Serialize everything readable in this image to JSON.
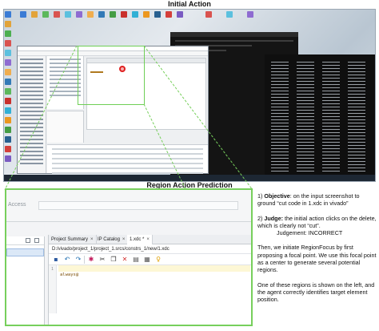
{
  "headings": {
    "initial_action": "Initial Action",
    "region_action_prediction": "Region Action Prediction"
  },
  "zoom": {
    "access_label": "Access",
    "tabs": [
      {
        "label": "Project Summary",
        "closable": true
      },
      {
        "label": "IP Catalog",
        "closable": true
      },
      {
        "label": "1.xdc *",
        "closable": true,
        "active": true
      }
    ],
    "file_path": "D:/vivado/project_1/project_1.srcs/constrs_1/new/1.xdc",
    "toolbar_icons": [
      "save-icon",
      "undo-icon",
      "redo-icon",
      "search-icon",
      "cut-icon",
      "copy-icon",
      "delete-icon",
      "block-icon",
      "grid-icon",
      "bulb-icon"
    ],
    "line_number": "1",
    "code_line": "always@"
  },
  "explanation": {
    "n1": "1)",
    "objective_label": "Objective",
    "objective_text": ": on the input screenshot to ground “cut code in 1.xdc in vivado”",
    "n2": "2)",
    "judge_label": "Judge:",
    "judge_text": " the initial action clicks on the delete, which is clearly not “cut”.",
    "judgement": "Judgement: INCORRECT",
    "para3": "Then, we initiate RegionFocus by first proposing a focal point. We use this focal point as a center to generate several potential regions.",
    "para4": "One of these regions is shown on the left, and the agent correctly identifies target element position."
  },
  "colors": {
    "highlight_green": "#77cf5c",
    "click_red": "#e02020",
    "code_highlight": "#fdf7d5"
  }
}
